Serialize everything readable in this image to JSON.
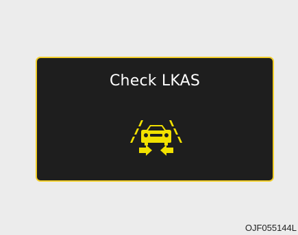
{
  "warning": {
    "message": "Check LKAS",
    "icon": "lkas-lane-keeping-icon"
  },
  "figure": {
    "code": "OJF055144L"
  },
  "colors": {
    "background": "#ececec",
    "panel": "#1e1e1e",
    "panel_border": "#f3cf29",
    "icon": "#f2e100",
    "text": "#ffffff",
    "code": "#1f1f1f"
  }
}
